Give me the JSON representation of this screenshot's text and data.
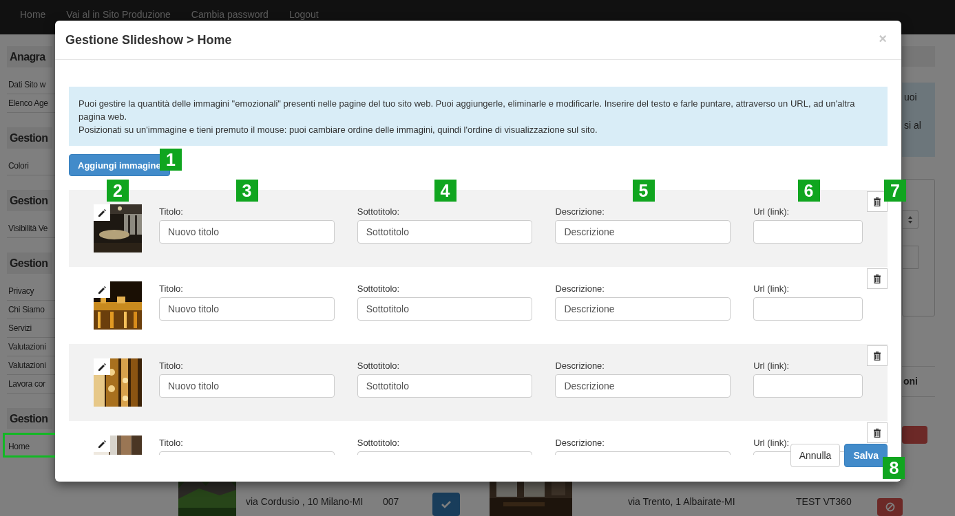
{
  "navbar": {
    "links": [
      "Home",
      "Vai al in Sito Produzione",
      "Cambia password",
      "Logout"
    ]
  },
  "sidebar": {
    "sections": [
      {
        "title": "Anagra",
        "items": [
          {
            "label": "Dati Sito w",
            "annotated": false
          },
          {
            "label": "Elenco Age",
            "annotated": false
          }
        ]
      },
      {
        "title": "Gestion",
        "items": [
          {
            "label": "Colori",
            "annotated": false
          }
        ]
      },
      {
        "title": "Gestion",
        "items": [
          {
            "label": "Visibilità Ve",
            "annotated": false
          }
        ]
      },
      {
        "title": "Gestion",
        "items": [
          {
            "label": "Privacy",
            "annotated": false
          },
          {
            "label": "Chi Siamo",
            "annotated": false
          },
          {
            "label": "Servizi",
            "annotated": false
          },
          {
            "label": "Valutazioni",
            "annotated": false
          },
          {
            "label": "Valutazioni",
            "annotated": false
          },
          {
            "label": "Lavora cor",
            "annotated": false
          }
        ]
      },
      {
        "title": "Gestion",
        "items": [
          {
            "label": "Home",
            "annotated": true
          }
        ]
      }
    ]
  },
  "main": {
    "alert_lines": [
      "uoi",
      "si al"
    ],
    "table_header": "oni",
    "upper_row_active": false,
    "listings": [
      {
        "photo": {
          "kind": "picture"
        },
        "address": "via Cordusio , 10 Milano-MI",
        "code": "007",
        "active": true
      },
      {
        "photo": {
          "kind": "picture"
        },
        "address": "via Trento, 1 Albairate-MI",
        "code": "TEST VT360",
        "active": false
      }
    ]
  },
  "modal": {
    "title": "Gestione Slideshow > Home",
    "close": "×",
    "info": [
      "Puoi gestire la quantità delle immagini \"emozionali\" presenti nelle pagine del tuo sito web. Puoi aggiungerle, eliminarle e modificarle. Inserire del testo e farle puntare, attraverso un URL, ad un'altra pagina web.",
      "Posizionati su un'immagine e tieni premuto il mouse: puoi cambiare ordine delle immagini, quindi l'ordine di visualizzazione sul sito."
    ],
    "add_button": {
      "label": "Aggiungi immagine",
      "callout": "1"
    },
    "slides": [
      {
        "thumbnail": {
          "kind": "picture"
        },
        "callout": "2",
        "trash_callout": "7",
        "fields": [
          {
            "label": "Titolo:",
            "value": "Nuovo titolo",
            "callout": "3"
          },
          {
            "label": "Sottotitolo:",
            "value": "Sottotitolo",
            "callout": "4"
          },
          {
            "label": "Descrizione:",
            "value": "Descrizione",
            "callout": "5"
          },
          {
            "label": "Url (link):",
            "callout": "6"
          }
        ]
      },
      {
        "thumbnail": {
          "kind": "picture"
        },
        "fields": [
          {
            "label": "Titolo:",
            "value": "Nuovo titolo"
          },
          {
            "label": "Sottotitolo:",
            "value": "Sottotitolo"
          },
          {
            "label": "Descrizione:",
            "value": "Descrizione"
          },
          {
            "label": "Url (link):"
          }
        ]
      },
      {
        "thumbnail": {
          "kind": "picture"
        },
        "fields": [
          {
            "label": "Titolo:",
            "value": "Nuovo titolo"
          },
          {
            "label": "Sottotitolo:",
            "value": "Sottotitolo"
          },
          {
            "label": "Descrizione:",
            "value": "Descrizione"
          },
          {
            "label": "Url (link):"
          }
        ]
      },
      {
        "thumbnail": {
          "kind": "picture"
        },
        "fields": [
          {
            "label": "Titolo:"
          },
          {
            "label": "Sottotitolo:"
          },
          {
            "label": "Descrizione:"
          },
          {
            "label": "Url (link):"
          }
        ]
      }
    ],
    "buttons": [
      {
        "label": "Annulla",
        "kind": "default"
      },
      {
        "label": "Salva",
        "kind": "primary",
        "callout": "8"
      }
    ]
  }
}
